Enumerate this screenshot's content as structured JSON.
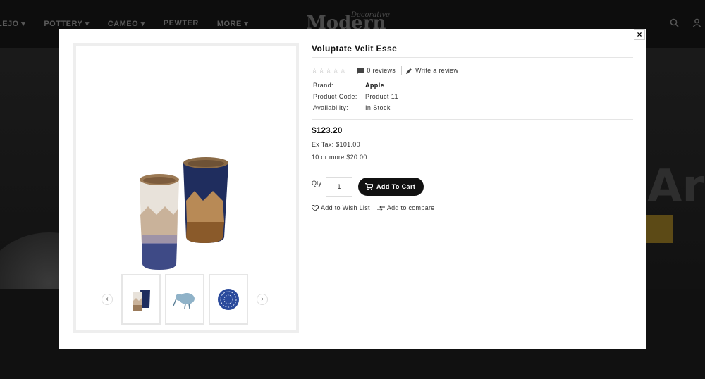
{
  "background": {
    "nav_items": [
      "LEJO ▾",
      "POTTERY ▾",
      "CAMEO ▾",
      "PEWTER",
      "MORE ▾"
    ],
    "logo_main": "Modern",
    "logo_sub": "Decorative",
    "hero_text": "Art",
    "icons": [
      "search-icon",
      "user-icon"
    ]
  },
  "modal": {
    "close_label": "×",
    "product": {
      "title": "Voluptate Velit Esse",
      "rating": 0,
      "reviews_label": "0 reviews",
      "write_review_label": "Write a review",
      "info": [
        {
          "key": "Brand:",
          "value": "Apple",
          "bold": true
        },
        {
          "key": "Product Code:",
          "value": "Product 11",
          "bold": false
        },
        {
          "key": "Availability:",
          "value": "In Stock",
          "bold": false
        }
      ],
      "price": "$123.20",
      "ex_tax": "Ex Tax: $101.00",
      "discount": "10 or more $20.00",
      "qty_label": "Qty",
      "qty_value": "1",
      "add_to_cart_label": "Add To Cart",
      "wishlist_label": "Add to Wish List",
      "compare_label": "Add to compare"
    },
    "gallery": {
      "prev_icon": "‹",
      "next_icon": "›",
      "thumbnails": [
        "cups-thumb",
        "kiwi-bird-thumb",
        "blue-plate-thumb"
      ]
    }
  },
  "colors": {
    "accent_dark": "#111111",
    "overlay": "#1a1a1a",
    "hero_button": "#5c4a16"
  }
}
